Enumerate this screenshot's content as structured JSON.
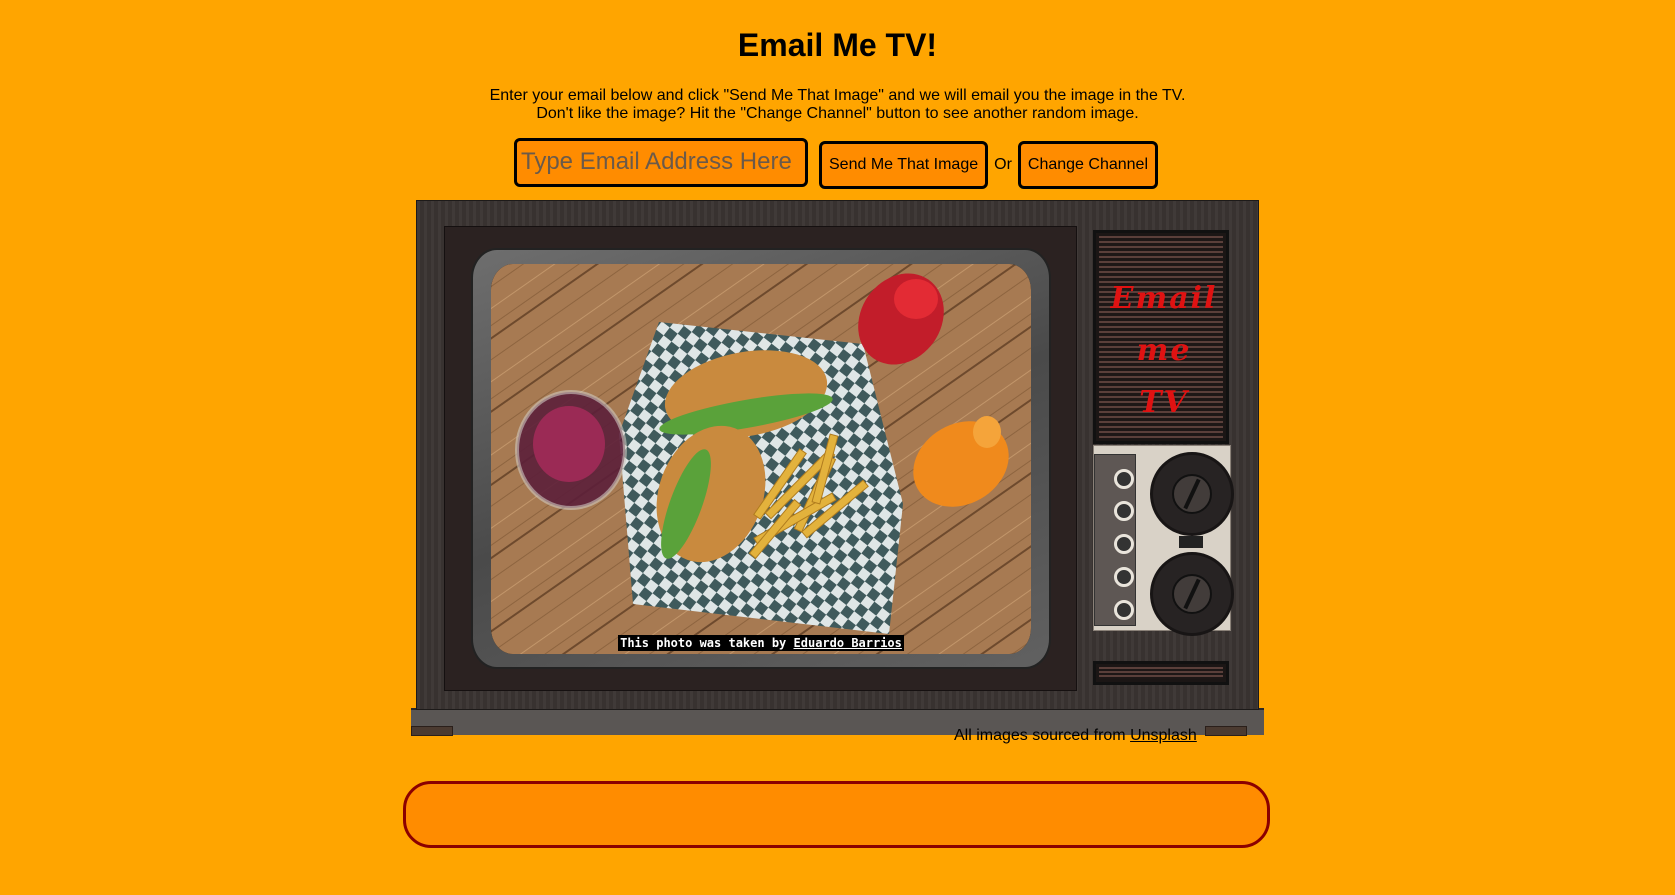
{
  "header": {
    "title": "Email Me TV!",
    "intro_line1": "Enter your email below and click \"Send Me That Image\" and we will email you the image in the TV.",
    "intro_line2": "Don't like the image? Hit the \"Change Channel\" button to see another random image."
  },
  "controls": {
    "email_placeholder": "Type Email Address Here",
    "email_value": "",
    "send_label": "Send Me That Image",
    "or_text": "Or",
    "change_channel_label": "Change Channel"
  },
  "tv": {
    "logo_lines": [
      "Email",
      "me",
      "TV"
    ],
    "photo_credit_prefix": "This photo was taken by",
    "photographer": "Eduardo Barrios"
  },
  "footer": {
    "source_prefix": "All images sourced from",
    "source_link": "Unsplash",
    "message_text": ""
  },
  "colors": {
    "background": "#ffa500",
    "control_fill": "#ff8c00",
    "message_border": "#8b0000",
    "logo_red": "#e01212"
  }
}
